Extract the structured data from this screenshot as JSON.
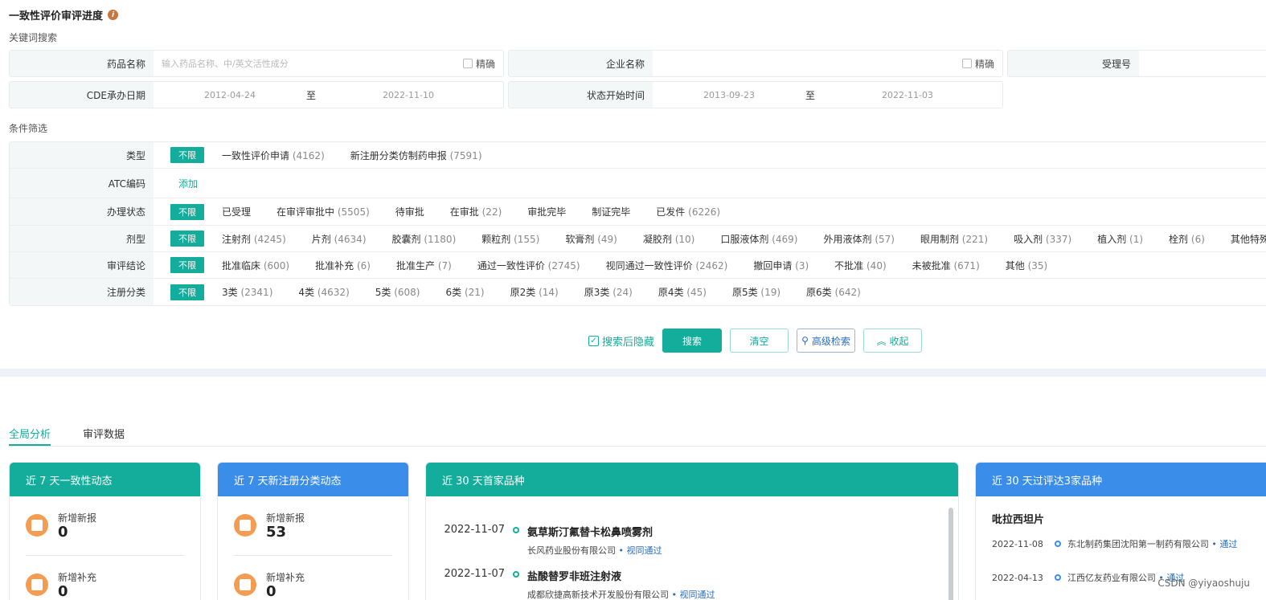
{
  "header": {
    "title": "一致性评价审评进度",
    "info_icon": "i"
  },
  "sections": {
    "keyword": "关键词搜索",
    "filter": "条件筛选"
  },
  "search": {
    "drug_name": {
      "label": "药品名称",
      "placeholder": "输入药品名称、中/英文活性成分",
      "exact": "精确"
    },
    "company": {
      "label": "企业名称",
      "exact": "精确"
    },
    "accept_no": {
      "label": "受理号"
    },
    "cde_date": {
      "label": "CDE承办日期",
      "from": "2012-04-24",
      "to_label": "至",
      "to": "2022-11-10"
    },
    "status_date": {
      "label": "状态开始时间",
      "from": "2013-09-23",
      "to_label": "至",
      "to": "2022-11-03"
    }
  },
  "filters": {
    "all_label": "不限",
    "type": {
      "label": "类型",
      "options": [
        {
          "name": "一致性评价申请",
          "count": "(4162)"
        },
        {
          "name": "新注册分类仿制药申报",
          "count": "(7591)"
        }
      ]
    },
    "atc": {
      "label": "ATC编码",
      "add": "添加"
    },
    "status": {
      "label": "办理状态",
      "options": [
        {
          "name": "已受理",
          "count": ""
        },
        {
          "name": "在审评审批中",
          "count": "(5505)"
        },
        {
          "name": "待审批",
          "count": ""
        },
        {
          "name": "在审批",
          "count": "(22)"
        },
        {
          "name": "审批完毕",
          "count": ""
        },
        {
          "name": "制证完毕",
          "count": ""
        },
        {
          "name": "已发件",
          "count": "(6226)"
        }
      ]
    },
    "dosage": {
      "label": "剂型",
      "options": [
        {
          "name": "注射剂",
          "count": "(4245)"
        },
        {
          "name": "片剂",
          "count": "(4634)"
        },
        {
          "name": "胶囊剂",
          "count": "(1180)"
        },
        {
          "name": "颗粒剂",
          "count": "(155)"
        },
        {
          "name": "软膏剂",
          "count": "(49)"
        },
        {
          "name": "凝胶剂",
          "count": "(10)"
        },
        {
          "name": "口服液体剂",
          "count": "(469)"
        },
        {
          "name": "外用液体剂",
          "count": "(57)"
        },
        {
          "name": "眼用制剂",
          "count": "(221)"
        },
        {
          "name": "吸入剂",
          "count": "(337)"
        },
        {
          "name": "植入剂",
          "count": "(1)"
        },
        {
          "name": "栓剂",
          "count": "(6)"
        },
        {
          "name": "其他特殊剂型",
          "count": ""
        }
      ]
    },
    "conclusion": {
      "label": "审评结论",
      "options": [
        {
          "name": "批准临床",
          "count": "(600)"
        },
        {
          "name": "批准补充",
          "count": "(6)"
        },
        {
          "name": "批准生产",
          "count": "(7)"
        },
        {
          "name": "通过一致性评价",
          "count": "(2745)"
        },
        {
          "name": "视同通过一致性评价",
          "count": "(2462)"
        },
        {
          "name": "撤回申请",
          "count": "(3)"
        },
        {
          "name": "不批准",
          "count": "(40)"
        },
        {
          "name": "未被批准",
          "count": "(671)"
        },
        {
          "name": "其他",
          "count": "(35)"
        }
      ]
    },
    "reg_class": {
      "label": "注册分类",
      "options": [
        {
          "name": "3类",
          "count": "(2341)"
        },
        {
          "name": "4类",
          "count": "(4632)"
        },
        {
          "name": "5类",
          "count": "(608)"
        },
        {
          "name": "6类",
          "count": "(21)"
        },
        {
          "name": "原2类",
          "count": "(14)"
        },
        {
          "name": "原3类",
          "count": "(24)"
        },
        {
          "name": "原4类",
          "count": "(45)"
        },
        {
          "name": "原5类",
          "count": "(19)"
        },
        {
          "name": "原6类",
          "count": "(642)"
        }
      ]
    }
  },
  "actions": {
    "hide_after": "搜索后隐藏",
    "search": "搜索",
    "clear": "清空",
    "advanced": "高级检索",
    "collapse": "收起"
  },
  "tabs": [
    {
      "label": "全局分析"
    },
    {
      "label": "审评数据"
    }
  ],
  "cards": {
    "c1": {
      "title": "近 7 天一致性动态",
      "s1_label": "新增新报",
      "s1_val": "0",
      "s2_label": "新增补充",
      "s2_val": "0"
    },
    "c2": {
      "title": "近 7 天新注册分类动态",
      "s1_label": "新增新报",
      "s1_val": "53",
      "s2_label": "新增补充",
      "s2_val": "0"
    },
    "c3": {
      "title": "近 30 天首家品种",
      "items": [
        {
          "date": "2022-11-07",
          "name": "氨草斯汀氟替卡松鼻喷雾剂",
          "company": "长风药业股份有限公司",
          "status": "视同通过"
        },
        {
          "date": "2022-11-07",
          "name": "盐酸替罗非班注射液",
          "company": "成都欣捷高新技术开发股份有限公司",
          "status": "视同通过"
        }
      ]
    },
    "c4": {
      "title": "近 30 天过评达3家品种",
      "drug": "吡拉西坦片",
      "items": [
        {
          "date": "2022-11-08",
          "company": "东北制药集团沈阳第一制药有限公司",
          "status": "通过"
        },
        {
          "date": "2022-04-13",
          "company": "江西亿友药业有限公司",
          "status": "通过"
        }
      ]
    }
  },
  "watermark": "CSDN @yiyaoshuju",
  "colors": {
    "teal": "#14ac9a",
    "blue": "#3a8de8",
    "orange": "#f39c52"
  }
}
